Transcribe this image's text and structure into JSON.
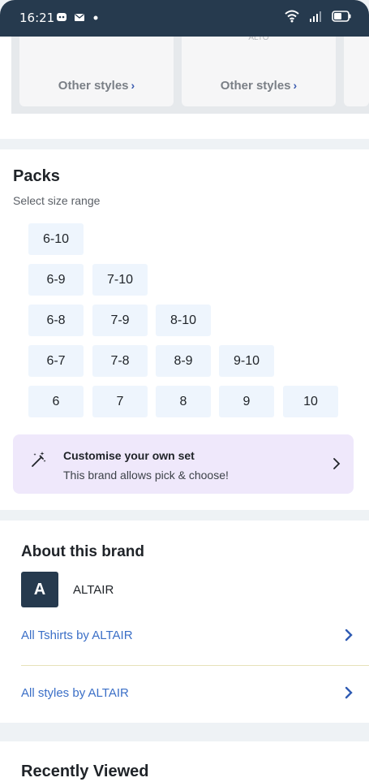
{
  "status_bar": {
    "time": "16:21",
    "left_icons": [
      "discord-icon",
      "mail-icon",
      "dot-icon"
    ],
    "right_icons": [
      "wifi-icon",
      "signal-icon",
      "battery-icon"
    ],
    "background": "#263a4e"
  },
  "styles_strip": {
    "cards": [
      {
        "label": "Other styles"
      },
      {
        "label": "Other styles",
        "faint_text": "ALTO"
      }
    ]
  },
  "packs": {
    "title": "Packs",
    "subtitle": "Select size range",
    "rows": [
      [
        "6-10"
      ],
      [
        "6-9",
        "7-10"
      ],
      [
        "6-8",
        "7-9",
        "8-10"
      ],
      [
        "6-7",
        "7-8",
        "8-9",
        "9-10"
      ],
      [
        "6",
        "7",
        "8",
        "9",
        "10"
      ]
    ],
    "customise": {
      "title": "Customise your own set",
      "subtitle": "This brand allows pick & choose!"
    }
  },
  "about": {
    "title": "About this brand",
    "brand_initial": "A",
    "brand_name": "ALTAIR",
    "links": [
      {
        "label": "All Tshirts by ALTAIR"
      },
      {
        "label": "All styles by ALTAIR"
      }
    ]
  },
  "recent": {
    "title": "Recently Viewed"
  },
  "colors": {
    "accent_link": "#3b6fc7",
    "chip_bg": "#eef5fd",
    "customise_bg": "#efe8fb",
    "brand_dark": "#263a4e"
  }
}
